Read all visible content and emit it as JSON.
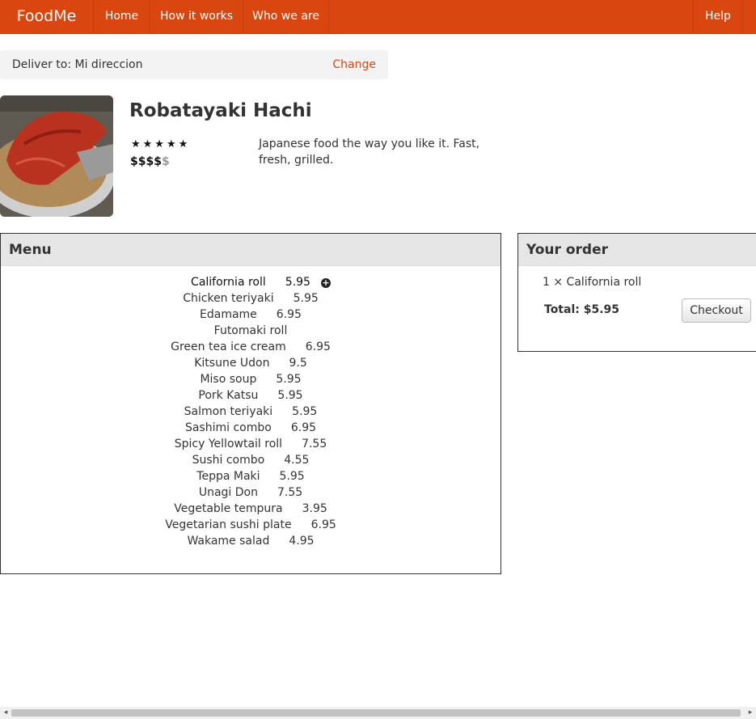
{
  "nav": {
    "brand": "FoodMe",
    "home": "Home",
    "how": "How it works",
    "who": "Who we are",
    "help": "Help"
  },
  "deliver": {
    "label": "Deliver to: Mi direccion",
    "change": "Change"
  },
  "restaurant": {
    "name": "Robatayaki Hachi",
    "stars": "★★★★★",
    "price_active": "$$$$",
    "price_inactive": "$",
    "description": "Japanese food the way you like it. Fast, fresh, grilled."
  },
  "menu": {
    "title": "Menu",
    "items": [
      {
        "name": "California roll",
        "price": "5.95"
      },
      {
        "name": "Chicken teriyaki",
        "price": "5.95"
      },
      {
        "name": "Edamame",
        "price": "6.95"
      },
      {
        "name": "Futomaki roll",
        "price": ""
      },
      {
        "name": "Green tea ice cream",
        "price": "6.95"
      },
      {
        "name": "Kitsune Udon",
        "price": "9.5"
      },
      {
        "name": "Miso soup",
        "price": "5.95"
      },
      {
        "name": "Pork Katsu",
        "price": "5.95"
      },
      {
        "name": "Salmon teriyaki",
        "price": "5.95"
      },
      {
        "name": "Sashimi combo",
        "price": "6.95"
      },
      {
        "name": "Spicy Yellowtail roll",
        "price": "7.55"
      },
      {
        "name": "Sushi combo",
        "price": "4.55"
      },
      {
        "name": "Teppa Maki",
        "price": "5.95"
      },
      {
        "name": "Unagi Don",
        "price": "7.55"
      },
      {
        "name": "Vegetable tempura",
        "price": "3.95"
      },
      {
        "name": "Vegetarian sushi plate",
        "price": "6.95"
      },
      {
        "name": "Wakame salad",
        "price": "4.95"
      }
    ]
  },
  "order": {
    "title": "Your order",
    "line": "1 × California roll",
    "total": "Total: $5.95",
    "checkout": "Checkout"
  },
  "colors": {
    "brand": "#d9460f",
    "panel_head": "#e6e6e6"
  }
}
